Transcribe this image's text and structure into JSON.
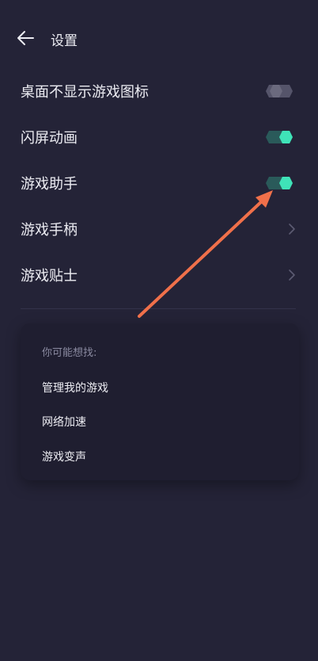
{
  "header": {
    "title": "设置",
    "back_icon": "arrow-left-icon"
  },
  "settings": {
    "hide_desktop_icon": {
      "label": "桌面不显示游戏图标",
      "enabled": false
    },
    "splash_animation": {
      "label": "闪屏动画",
      "enabled": true
    },
    "game_assistant": {
      "label": "游戏助手",
      "enabled": true
    },
    "gamepad": {
      "label": "游戏手柄"
    },
    "game_tips": {
      "label": "游戏贴士"
    }
  },
  "suggestions": {
    "title": "你可能想找:",
    "items": [
      "管理我的游戏",
      "网络加速",
      "游戏变声"
    ]
  },
  "colors": {
    "background": "#242337",
    "toggle_on_knob": "#3FE3B8",
    "toggle_on_track": "#2A5A5A",
    "toggle_off_knob": "#6B6A7E",
    "toggle_off_track": "#55546A",
    "annotation_arrow": "#F0704A"
  }
}
